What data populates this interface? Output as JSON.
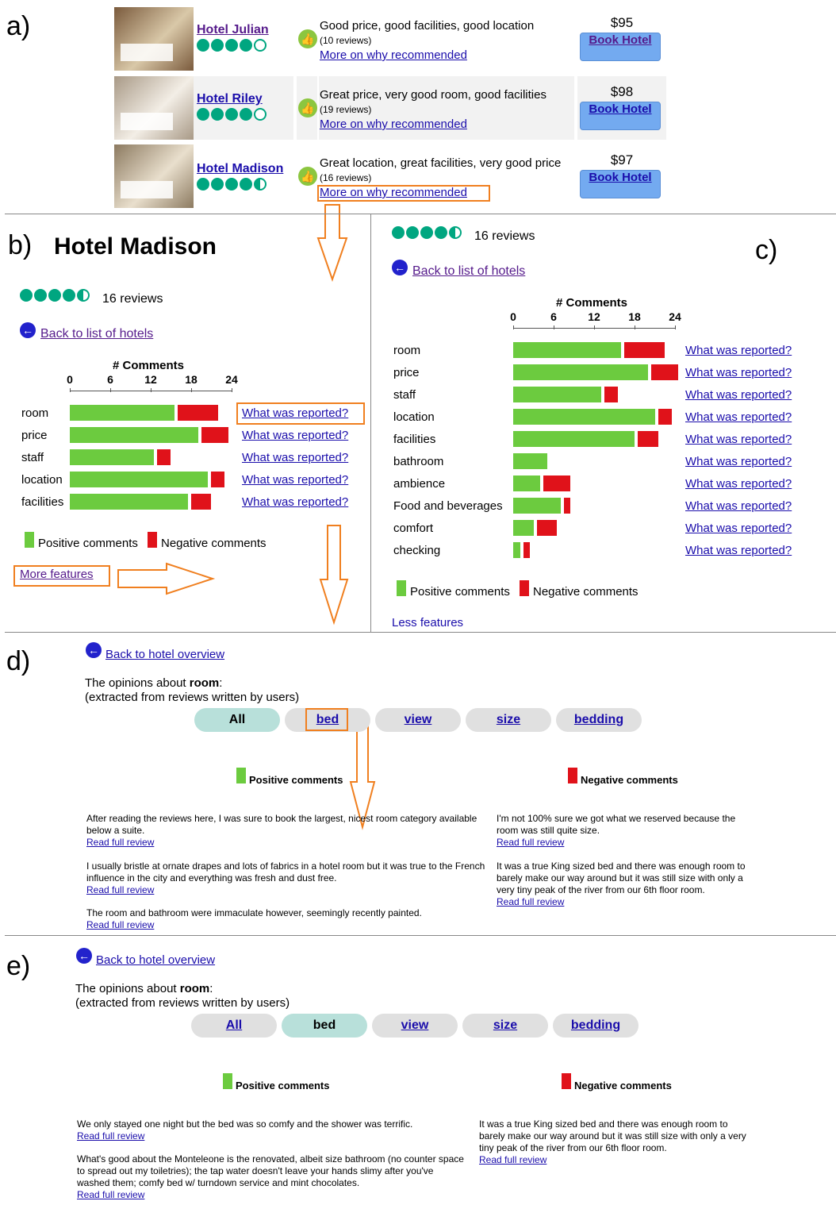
{
  "panel_letters": {
    "a": "a)",
    "b": "b)",
    "c": "c)",
    "d": "d)",
    "e": "e)"
  },
  "colors": {
    "positive": "#6ccb3f",
    "negative": "#e0121a",
    "rating": "#00a680",
    "annotation": "#f07f1f",
    "link": "#1a0dab"
  },
  "hotels": [
    {
      "name": "Hotel Julian",
      "rating": 4,
      "summary": "Good price, good facilities, good location",
      "reviews": "(10 reviews)",
      "why": "More on why recommended",
      "price": "$95",
      "book": "Book Hotel"
    },
    {
      "name": "Hotel Riley",
      "rating": 4,
      "summary": "Great price, very good room, good facilities",
      "reviews": "(19 reviews)",
      "why": "More on why recommended",
      "price": "$98",
      "book": "Book Hotel"
    },
    {
      "name": "Hotel Madison",
      "rating": 4.5,
      "summary": "Great location, great facilities, very good price",
      "reviews": "(16 reviews)",
      "why": "More on why recommended",
      "price": "$97",
      "book": "Book Hotel"
    }
  ],
  "panel_b": {
    "title": "Hotel Madison",
    "rating": 4.5,
    "reviews": "16 reviews",
    "back": "Back to list of hotels",
    "more": "More features",
    "legend_pos": "Positive comments",
    "legend_neg": "Negative comments"
  },
  "panel_c": {
    "rating": 4.5,
    "reviews": "16 reviews",
    "back": "Back to list of hotels",
    "less": "Less features",
    "legend_pos": "Positive comments",
    "legend_neg": "Negative comments"
  },
  "chart_data": [
    {
      "type": "bar",
      "orientation": "horizontal-stacked",
      "title": "# Comments",
      "ticks": [
        0,
        6,
        12,
        18,
        24
      ],
      "xlim": [
        0,
        24
      ],
      "categories": [
        "room",
        "price",
        "staff",
        "location",
        "facilities"
      ],
      "series": [
        {
          "name": "Positive comments",
          "values": [
            15.5,
            19,
            12.5,
            20.5,
            17.5
          ]
        },
        {
          "name": "Negative comments",
          "values": [
            6,
            4,
            2,
            2,
            3
          ]
        }
      ],
      "link_text": "What was reported?"
    },
    {
      "type": "bar",
      "orientation": "horizontal-stacked",
      "title": "# Comments",
      "ticks": [
        0,
        6,
        12,
        18,
        24
      ],
      "xlim": [
        0,
        24
      ],
      "categories": [
        "room",
        "price",
        "staff",
        "location",
        "facilities",
        "bathroom",
        "ambience",
        "Food and beverages",
        "comfort",
        "checking"
      ],
      "series": [
        {
          "name": "Positive comments",
          "values": [
            16,
            20,
            13,
            21,
            18,
            5,
            4,
            7,
            3,
            1
          ]
        },
        {
          "name": "Negative comments",
          "values": [
            6,
            4,
            2,
            2,
            3,
            0,
            4,
            1,
            3,
            1
          ]
        }
      ],
      "link_text": "What was reported?"
    }
  ],
  "panel_d": {
    "back": "Back to hotel overview",
    "intro_prefix": "The opinions about ",
    "intro_topic": "room",
    "intro_suffix": ":",
    "intro_sub": "(extracted from reviews written by users)",
    "tabs": [
      "All",
      "bed",
      "view",
      "size",
      "bedding"
    ],
    "active_tab": "All",
    "pos_head": "Positive comments",
    "neg_head": "Negative comments",
    "positive": [
      {
        "text": "After reading the reviews here, I was sure to book the largest, nicest room category available below a suite.",
        "link": "Read full review"
      },
      {
        "text": "I usually bristle at ornate drapes and lots of fabrics in a hotel room but it was true to the French influence in the city and everything was fresh and dust free.",
        "link": "Read full review"
      },
      {
        "text": "The room and bathroom were immaculate however, seemingly recently painted.",
        "link": "Read full review"
      }
    ],
    "negative": [
      {
        "text": "I'm not 100% sure we got what we reserved because the room was still quite size.",
        "link": "Read full review"
      },
      {
        "text": "It was a true King sized bed and there was enough room to barely make our way around but it was still size with only a very tiny peak of the river from our 6th floor room.",
        "link": "Read full review"
      }
    ]
  },
  "panel_e": {
    "back": "Back to hotel overview",
    "intro_prefix": "The opinions about ",
    "intro_topic": "room",
    "intro_suffix": ":",
    "intro_sub": "(extracted from reviews written by users)",
    "tabs": [
      "All",
      "bed",
      "view",
      "size",
      "bedding"
    ],
    "active_tab": "bed",
    "pos_head": "Positive comments",
    "neg_head": "Negative comments",
    "positive": [
      {
        "text": "We only stayed one night but the bed was so comfy and the shower was terrific.",
        "link": "Read full review"
      },
      {
        "text": "What's good about the Monteleone is the renovated, albeit size bathroom (no counter space to spread out my toiletries); the tap water doesn't leave your hands slimy after you've washed them; comfy bed w/ turndown service and mint chocolates.",
        "link": "Read full review"
      }
    ],
    "negative": [
      {
        "text": "It was a true King sized bed and there was enough room to barely make our way around but it was still size with only a very tiny peak of the river from our 6th floor room.",
        "link": "Read full review"
      }
    ]
  }
}
